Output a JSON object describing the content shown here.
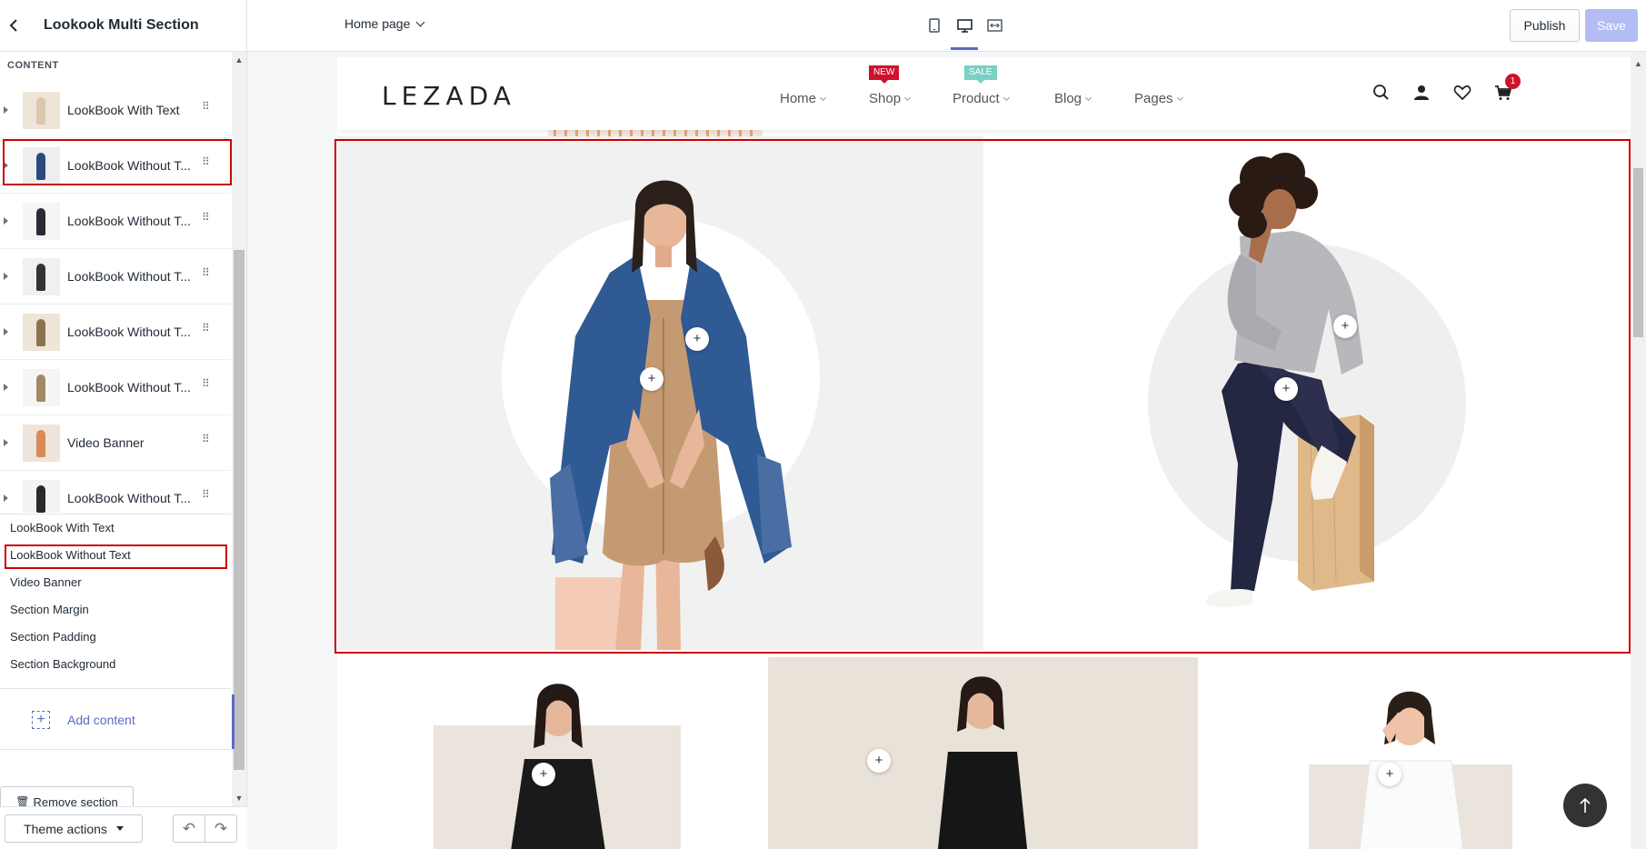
{
  "sidebar": {
    "title": "Lookook Multi Section",
    "content_heading": "CONTENT",
    "blocks": [
      {
        "label": "LookBook With Text",
        "thumb_color": "#eee5d8",
        "fig_color": "#d9c7ae"
      },
      {
        "label": "LookBook Without T...",
        "thumb_color": "#eeeeee",
        "fig_color": "#2d4a7a"
      },
      {
        "label": "LookBook Without T...",
        "thumb_color": "#f5f5f5",
        "fig_color": "#2a2a36"
      },
      {
        "label": "LookBook Without T...",
        "thumb_color": "#f0f0f0",
        "fig_color": "#333333"
      },
      {
        "label": "LookBook Without T...",
        "thumb_color": "#eee5d8",
        "fig_color": "#8a7350"
      },
      {
        "label": "LookBook Without T...",
        "thumb_color": "#f5f5f5",
        "fig_color": "#a08a66"
      },
      {
        "label": "Video Banner",
        "thumb_color": "#efe4dc",
        "fig_color": "#d98a56"
      },
      {
        "label": "LookBook Without T...",
        "thumb_color": "#f3f3f3",
        "fig_color": "#2a2a2a"
      }
    ],
    "options": [
      "LookBook With Text",
      "LookBook Without Text",
      "Video Banner",
      "Section Margin",
      "Section Padding",
      "Section Background"
    ],
    "add_content": "Add content",
    "remove_section": "Remove section",
    "theme_actions": "Theme actions"
  },
  "topbar": {
    "page_select": "Home page",
    "publish": "Publish",
    "save": "Save"
  },
  "store": {
    "logo": "LEZADA",
    "nav": [
      "Home",
      "Shop",
      "Product",
      "Blog",
      "Pages"
    ],
    "tag_new": "NEW",
    "tag_sale": "SALE",
    "cart_count": "1"
  },
  "colors": {
    "accent": "#5c6ac4",
    "highlight": "#cc0000",
    "badge": "#d0112b",
    "sale": "#7ad0c2",
    "save_disabled": "#b3bcf5"
  },
  "icons": {
    "hotspot": "+",
    "undo": "↶",
    "redo": "↷",
    "back_to_top": "arrow-up-icon"
  }
}
